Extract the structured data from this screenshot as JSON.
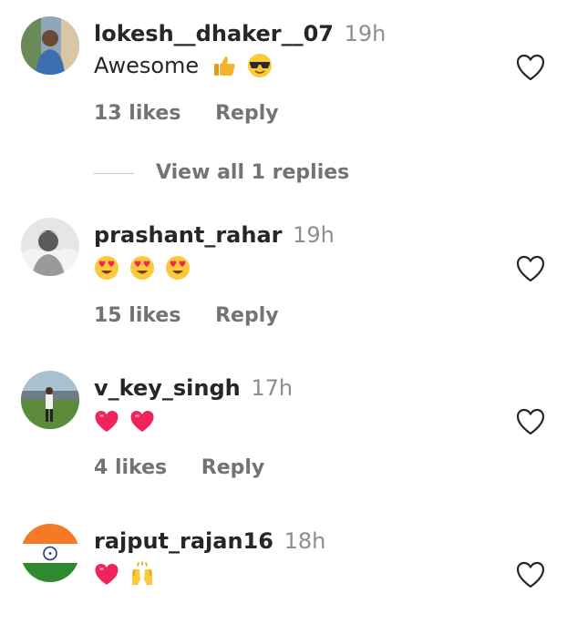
{
  "comments": [
    {
      "username": "lokesh__dhaker__07",
      "time": "19h",
      "text": "Awesome",
      "emojis": [
        "thumbs-up",
        "smiling-face-with-sunglasses"
      ],
      "likes": "13 likes",
      "reply": "Reply"
    },
    {
      "username": "prashant_rahar",
      "time": "19h",
      "text": "",
      "emojis": [
        "heart-eyes",
        "heart-eyes",
        "heart-eyes"
      ],
      "likes": "15 likes",
      "reply": "Reply"
    },
    {
      "username": "v_key_singh",
      "time": "17h",
      "text": "",
      "emojis": [
        "red-heart",
        "red-heart"
      ],
      "likes": "4 likes",
      "reply": "Reply"
    },
    {
      "username": "rajput_rajan16",
      "time": "18h",
      "text": "",
      "emojis": [
        "red-heart",
        "raising-hands"
      ],
      "likes": "",
      "reply": ""
    }
  ],
  "view_replies": "View all 1 replies",
  "colors": {
    "text": "#262626",
    "secondary": "#737373",
    "time": "#8e8e8e",
    "divider": "#c7c7c7"
  }
}
